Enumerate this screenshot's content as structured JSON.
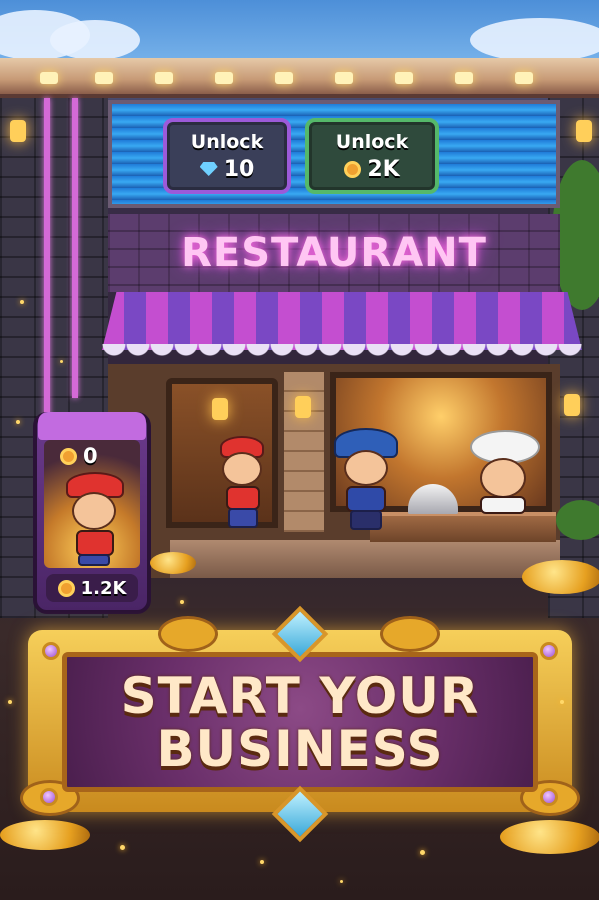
{
  "store": {
    "sign_name": "RESTAURANT",
    "unlock_gems": {
      "title": "Unlock",
      "cost": "10",
      "currency_icon": "gem-icon"
    },
    "unlock_coins": {
      "title": "Unlock",
      "cost": "2K",
      "currency_icon": "coin-icon"
    }
  },
  "worker_tube": {
    "count": "0",
    "earnings": "1.2K"
  },
  "banner": {
    "line1": "START YOUR",
    "line2": "BUSINESS"
  },
  "colors": {
    "gem_border": "#9c5ad9",
    "coin_border": "#55b86a",
    "sign_glow": "#ff6ee0",
    "banner_gold": "#f6cf5a"
  }
}
